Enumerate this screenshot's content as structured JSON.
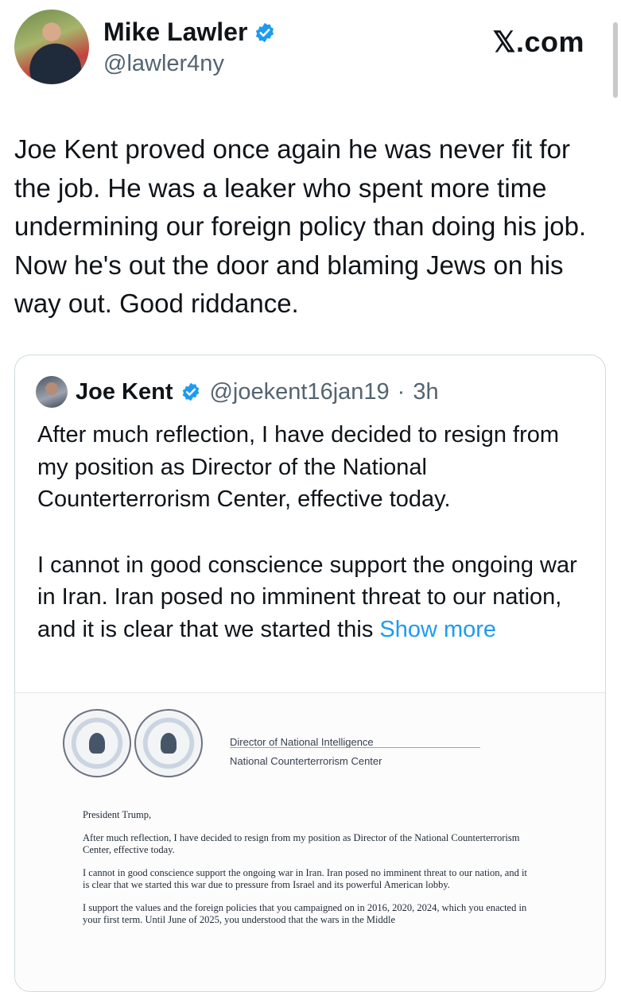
{
  "header": {
    "name": "Mike Lawler",
    "handle": "@lawler4ny",
    "site_label": "𝕏.com"
  },
  "tweet": {
    "text": "Joe Kent proved once again he was never fit for the job. He was a leaker who spent more time undermining our foreign policy than doing his job. Now he's out the door and blaming Jews on his way out. Good riddance."
  },
  "quote": {
    "name": "Joe Kent",
    "handle": "@joekent16jan19",
    "sep": "·",
    "time": "3h",
    "paragraph1": "After much reflection, I have decided to resign from my position as Director of the National Counterterrorism Center, effective today.",
    "paragraph2": "I cannot in good conscience support the ongoing war in Iran. Iran posed no imminent threat to our nation, and it is clear that we started this ",
    "show_more": "Show more"
  },
  "letter": {
    "letterhead_line1": "Director of National Intelligence",
    "letterhead_line2": "National Counterterrorism Center",
    "salutation": "President Trump,",
    "p1": "After much reflection, I have decided to resign from my position as Director of the National Counterterrorism Center, effective today.",
    "p2": "I cannot in good conscience support the ongoing war in Iran. Iran posed no imminent threat to our nation, and it is clear that we started this war due to pressure from Israel and its powerful American lobby.",
    "p3": "I support the values and the foreign policies that you campaigned on in 2016, 2020, 2024, which you enacted in your first term. Until June of 2025, you understood that the wars in the Middle"
  },
  "colors": {
    "link": "#1d9bf0",
    "verified": "#1d9bf0",
    "muted": "#536471"
  },
  "icons": [
    "verified-badge-icon"
  ]
}
